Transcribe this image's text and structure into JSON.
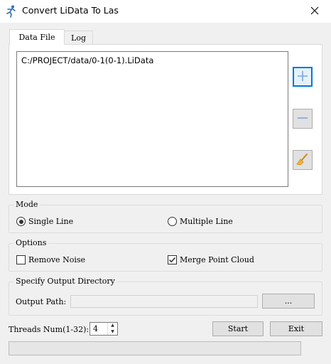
{
  "window": {
    "title": "Convert LiData To Las",
    "app_icon": "running-figure-icon",
    "close_icon": "close-icon"
  },
  "tabs": [
    {
      "label": "Data File",
      "active": true
    },
    {
      "label": "Log",
      "active": false
    }
  ],
  "file_list": {
    "items": [
      "C:/PROJECT/data/0-1(0-1).LiData"
    ]
  },
  "side_buttons": {
    "add_icon": "plus-icon",
    "remove_icon": "minus-icon",
    "clear_icon": "broom-icon"
  },
  "mode": {
    "title": "Mode",
    "options": [
      "Single Line",
      "Multiple Line"
    ],
    "selected": "Single Line"
  },
  "options": {
    "title": "Options",
    "remove_noise": {
      "label": "Remove Noise",
      "checked": false
    },
    "merge_point_cloud": {
      "label": "Merge Point Cloud",
      "checked": true
    }
  },
  "output": {
    "title": "Specify Output Directory",
    "path_label": "Output Path:",
    "path_value": "",
    "browse_label": "..."
  },
  "threads": {
    "label": "Threads Num(1-32):",
    "value": "4"
  },
  "actions": {
    "start_label": "Start",
    "exit_label": "Exit"
  },
  "progress": {
    "value": 0
  },
  "colors": {
    "focus_blue": "#0078d7",
    "face": "#f0f0f0"
  }
}
